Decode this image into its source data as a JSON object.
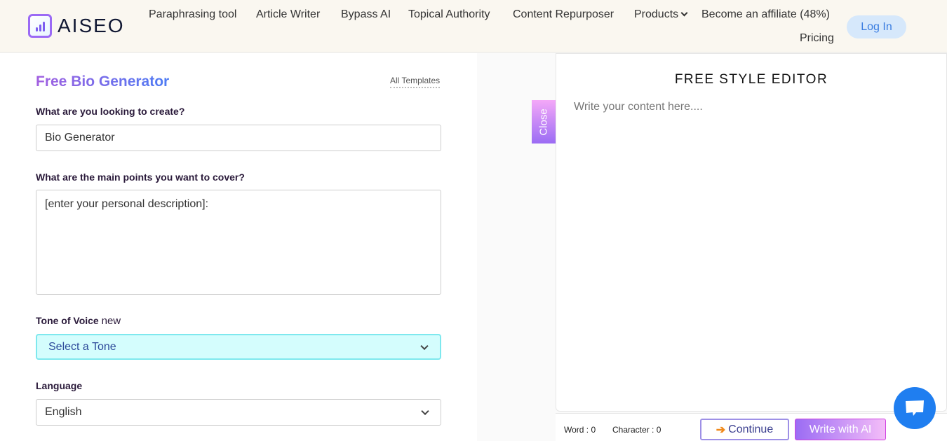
{
  "header": {
    "logo": "AISEO",
    "nav": [
      "Paraphrasing tool",
      "Article Writer",
      "Bypass AI",
      "Topical Authority",
      "Content Repurposer",
      "Products",
      "Become an affiliate (48%)",
      "Pricing"
    ],
    "login": "Log In"
  },
  "form": {
    "title": "Free Bio Generator",
    "all_templates": "All Templates",
    "create_label": "What are you looking to create?",
    "create_value": "Bio Generator",
    "points_label": "What are the main points you want to cover?",
    "points_value": "[enter your personal description]:",
    "tone_label": "Tone of Voice",
    "tone_badge": "new",
    "tone_value": "Select a Tone",
    "language_label": "Language",
    "language_value": "English"
  },
  "editor": {
    "close": "Close",
    "title": "FREE STYLE EDITOR",
    "placeholder": "Write your content here....",
    "word": "Word : 0",
    "character": "Character : 0",
    "continue": "Continue",
    "write_ai": "Write with AI"
  },
  "colors": {
    "accent": "#9b6cf4",
    "chat": "#1f7ef0",
    "tone_bg": "#d4fdfd"
  }
}
